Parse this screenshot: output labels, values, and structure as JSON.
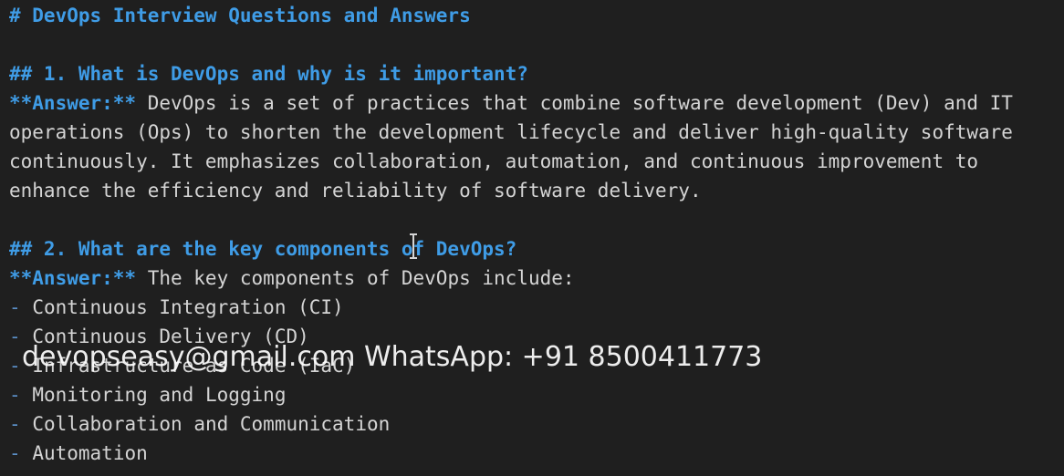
{
  "document": {
    "title": "# DevOps Interview Questions and Answers",
    "q1": {
      "heading": "## 1. What is DevOps and why is it important?",
      "answer_label": "**Answer:**",
      "answer_line1": " DevOps is a set of practices that combine software development (Dev) and IT",
      "answer_line2": "operations (Ops) to shorten the development lifecycle and deliver high-quality software",
      "answer_line3": "continuously. It emphasizes collaboration, automation, and continuous improvement to",
      "answer_line4": "enhance the efficiency and reliability of software delivery."
    },
    "q2": {
      "heading": "## 2. What are the key components of DevOps?",
      "answer_label": "**Answer:**",
      "answer_text": " The key components of DevOps include:",
      "bullet_marker": "-",
      "items": [
        "Continuous Integration (CI)",
        "Continuous Delivery (CD)",
        "Infrastructure as Code (IaC)",
        "Monitoring and Logging",
        "Collaboration and Communication",
        "Automation"
      ]
    }
  },
  "overlay": {
    "watermark": "devopseasy@gmail.com WhatsApp: +91 8500411773"
  },
  "colors": {
    "background": "#1f1f1f",
    "heading": "#3f9ce6",
    "text": "#d4d4d4"
  }
}
